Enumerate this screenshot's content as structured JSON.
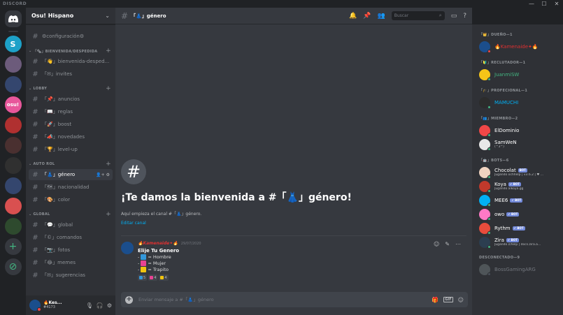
{
  "window": {
    "brand": "DISCORD",
    "minimize": "—",
    "maximize": "☐",
    "close": "✕"
  },
  "guild": {
    "name": "Osu! Hispano"
  },
  "channel_header": {
    "name": "「👗」género",
    "search_placeholder": "Buscar"
  },
  "sidebar": {
    "top_channel": "⚙configuración⚙",
    "categories": [
      {
        "name": "「🗞」BIENVENIDA/DESPEDIDA",
        "channels": [
          "「👋」bienvenida-desped...",
          "「✉」invites"
        ]
      },
      {
        "name": "LOBBY",
        "channels": [
          "「📌」anuncios",
          "「📖」reglas",
          "「🚀」boost",
          "「📣」novedades",
          "「🏆」level-up"
        ]
      },
      {
        "name": "AUTO ROL",
        "channels": [
          "「👗」género",
          "「🗺」nacionalidad",
          "「🎨」color"
        ]
      },
      {
        "name": "GLOBAL",
        "channels": [
          "「💬」global",
          "「©」comandos",
          "「📷」fotos",
          "「😂」memes",
          "「✉」sugerencias"
        ]
      }
    ]
  },
  "user": {
    "name": "🔥Kes...",
    "tag": "#4173"
  },
  "welcome": {
    "title": "¡Te damos la bienvenida a #「👗」género!",
    "subtitle": "Aquí empieza el canal #「👗」género.",
    "edit_link": "Editar canal"
  },
  "message": {
    "author": "🔥Kamenaide✦🔥",
    "date": "29/07/2020",
    "title": "Elije Tu Genero",
    "lines": [
      {
        "prefix": "-",
        "emoji_color": "#3498db",
        "text": "= Hombre"
      },
      {
        "prefix": "-",
        "emoji_color": "#e84393",
        "text": "= Mujer"
      },
      {
        "prefix": "-",
        "emoji_color": "#f1c40f",
        "text": "= Trapito"
      }
    ],
    "reactions": [
      {
        "color": "#3498db",
        "count": "5"
      },
      {
        "color": "#e84393",
        "count": "4"
      },
      {
        "color": "#f1c40f",
        "count": "4"
      }
    ]
  },
  "composer": {
    "placeholder": "Enviar mensaje a #「👗」género"
  },
  "members": {
    "groups": [
      {
        "role": "「👑」DUEÑO—1",
        "members": [
          {
            "name": "🔥Kamenaide✦🔥",
            "color": "#e03131",
            "avatar": "#1b4e8c",
            "status": "#f04747"
          }
        ]
      },
      {
        "role": "「🔰」RECLUTADOR—1",
        "members": [
          {
            "name": "JuanmiSW",
            "color": "#43b581",
            "avatar": "#f5c518",
            "status": "#43b581"
          }
        ]
      },
      {
        "role": "「🎓」PROFECIONAL—1",
        "members": [
          {
            "name": "MAMUCHI",
            "color": "#00b0f4",
            "avatar": "#2c2c2c",
            "status": "#43b581"
          }
        ]
      },
      {
        "role": "「👥」MIEMBRO—2",
        "members": [
          {
            "name": "ElDominio",
            "color": "#ffffff",
            "avatar": "#f04747",
            "status": "#43b581"
          },
          {
            "name": "SamWeN",
            "activity": "(^3^)",
            "color": "#ffffff",
            "avatar": "#e8e8e8",
            "status": "#43b581"
          }
        ]
      },
      {
        "role": "「🤖」BOTS—6",
        "members": [
          {
            "name": "Chocolat",
            "bot": "BOT",
            "activity": "Jugando ochhelp | v3.6.2 | ♥ ...",
            "color": "#ffffff",
            "avatar": "#f1d3c0",
            "status": "#43b581"
          },
          {
            "name": "Koya",
            "bot": "✔ BOT",
            "activity": "Jugando alkoya.gg",
            "color": "#ffffff",
            "avatar": "#c0392b",
            "status": "#43b581"
          },
          {
            "name": "MEE6",
            "bot": "✔ BOT",
            "color": "#ffffff",
            "avatar": "#00b0f4",
            "status": "#43b581"
          },
          {
            "name": "owo",
            "bot": "✔ BOT",
            "color": "#ffffff",
            "avatar": "#ff79c6",
            "status": "#43b581"
          },
          {
            "name": "Rythm",
            "bot": "✔ BOT",
            "color": "#ffffff",
            "avatar": "#e74c3c",
            "status": "#43b581"
          },
          {
            "name": "Zira",
            "bot": "✔ BOT",
            "activity": "Jugando z/help | docs.zira.a...",
            "color": "#ffffff",
            "avatar": "#2c3e50",
            "status": "#43b581"
          }
        ]
      },
      {
        "role": "DESCONECTADO—9",
        "offline": true,
        "members": [
          {
            "name": "BossGamingARG",
            "color": "#ffffff",
            "avatar": "#7f8c8d",
            "status": "#747f8d"
          }
        ]
      }
    ]
  },
  "servers": [
    {
      "label": "S",
      "color": "#1da1c8"
    },
    {
      "label": "",
      "color": "#6c5b7b"
    },
    {
      "label": "",
      "color": "#34466e"
    },
    {
      "label": "osu!",
      "color": "#e8579b"
    },
    {
      "label": "",
      "color": "#b03030"
    },
    {
      "label": "",
      "color": "#4a3030"
    },
    {
      "label": "",
      "color": "#303030"
    },
    {
      "label": "",
      "color": "#34466e"
    },
    {
      "label": "",
      "color": "#d95050"
    },
    {
      "label": "",
      "color": "#2e4a2e"
    }
  ]
}
